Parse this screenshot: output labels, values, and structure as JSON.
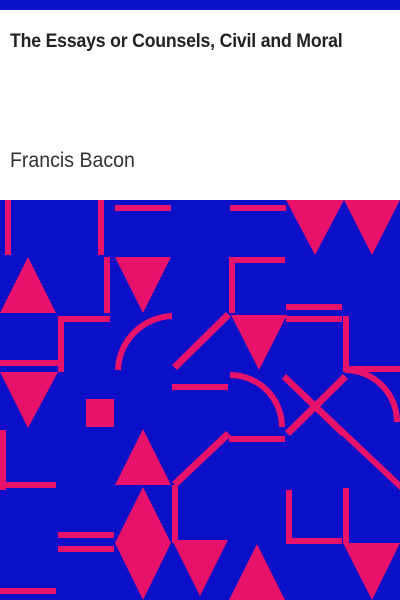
{
  "cover": {
    "title": "The Essays or Counsels, Civil and Moral",
    "author": "Francis Bacon"
  },
  "colors": {
    "top_bar": "#0a10c8",
    "pattern_background": "#0a10c8",
    "pattern_shapes": "#e8126a",
    "page_background": "#ffffff",
    "text": "#222222"
  }
}
